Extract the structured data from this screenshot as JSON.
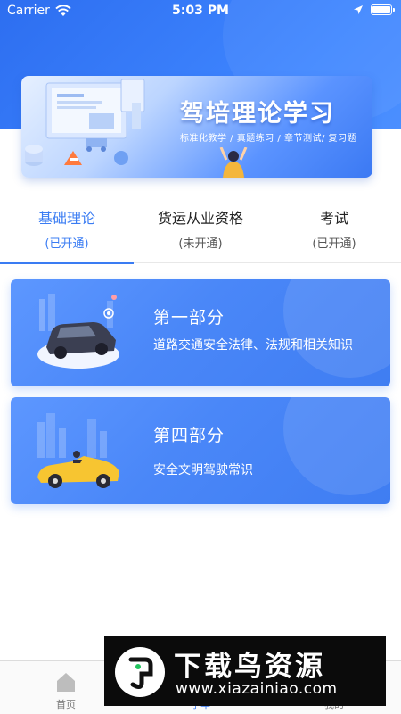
{
  "status_bar": {
    "carrier": "Carrier",
    "time": "5:03 PM"
  },
  "banner": {
    "title": "驾培理论学习",
    "subtitle": "标准化教学 / 真题练习 / 章节测试/ 复习题"
  },
  "tabs": [
    {
      "label": "基础理论",
      "status": "(已开通)",
      "active": true
    },
    {
      "label": "货运从业资格",
      "status": "(未开通)",
      "active": false
    },
    {
      "label": "考试",
      "status": "(已开通)",
      "active": false
    }
  ],
  "cards": [
    {
      "title": "第一部分",
      "description": "道路交通安全法律、法规和相关知识"
    },
    {
      "title": "第四部分",
      "description": "安全文明驾驶常识"
    }
  ],
  "tabbar": {
    "items": [
      {
        "label": "首页",
        "icon": "home-icon"
      },
      {
        "label": "学车",
        "icon": "study-icon",
        "active": true
      },
      {
        "label": "我的",
        "icon": "user-icon"
      }
    ]
  },
  "watermark": {
    "main": "下载鸟资源",
    "url": "www.xiazainiao.com"
  },
  "colors": {
    "primary": "#3a7cf3",
    "header": "#2d6ef0",
    "card": "#4a87f8"
  }
}
